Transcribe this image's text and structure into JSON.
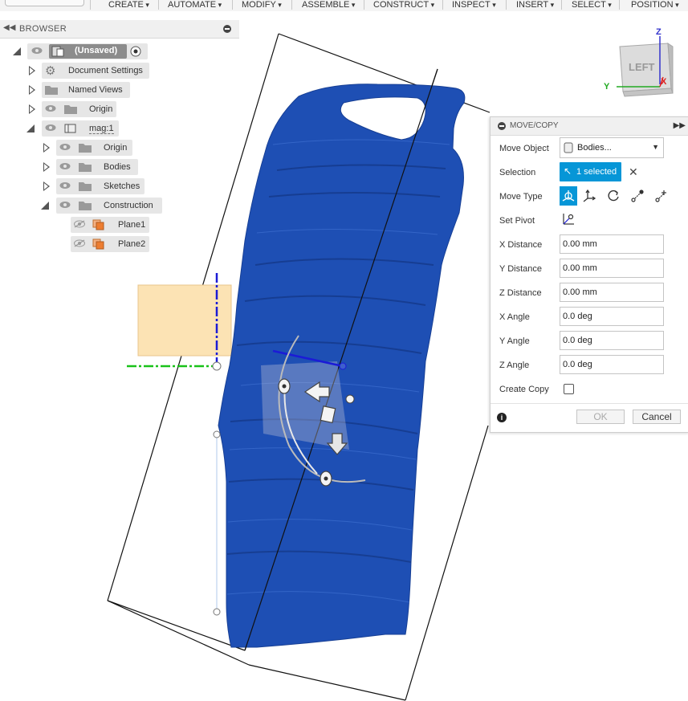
{
  "toolbar": {
    "menus": [
      "CREATE",
      "AUTOMATE",
      "MODIFY",
      "ASSEMBLE",
      "CONSTRUCT",
      "INSPECT",
      "INSERT",
      "SELECT",
      "POSITION"
    ]
  },
  "browser": {
    "title": "BROWSER",
    "root": {
      "label": "(Unsaved)"
    },
    "items": {
      "document_settings": "Document Settings",
      "named_views": "Named Views",
      "origin": "Origin",
      "component": "mag:1",
      "comp_origin": "Origin",
      "bodies": "Bodies",
      "sketches": "Sketches",
      "construction": "Construction",
      "plane1": "Plane1",
      "plane2": "Plane2"
    }
  },
  "viewcube": {
    "face": "LEFT",
    "axes": {
      "z": "Z",
      "y": "Y",
      "x": "X"
    }
  },
  "dialog": {
    "title": "MOVE/COPY",
    "move_object_label": "Move Object",
    "move_object_value": "Bodies...",
    "selection_label": "Selection",
    "selection_value": "1 selected",
    "move_type_label": "Move Type",
    "set_pivot_label": "Set Pivot",
    "x_distance_label": "X Distance",
    "x_distance_value": "0.00 mm",
    "y_distance_label": "Y Distance",
    "y_distance_value": "0.00 mm",
    "z_distance_label": "Z Distance",
    "z_distance_value": "0.00 mm",
    "x_angle_label": "X Angle",
    "x_angle_value": "0.0 deg",
    "y_angle_label": "Y Angle",
    "y_angle_value": "0.0 deg",
    "z_angle_label": "Z Angle",
    "z_angle_value": "0.0 deg",
    "create_copy_label": "Create Copy",
    "create_copy_checked": false,
    "ok_label": "OK",
    "cancel_label": "Cancel"
  },
  "colors": {
    "body_blue": "#1e4fb4",
    "accent_blue": "#0696d7",
    "plane_orange": "#fce3b4",
    "axis_green": "#19c219",
    "axis_blue": "#1b1bd6",
    "axis_red": "#e02020"
  }
}
